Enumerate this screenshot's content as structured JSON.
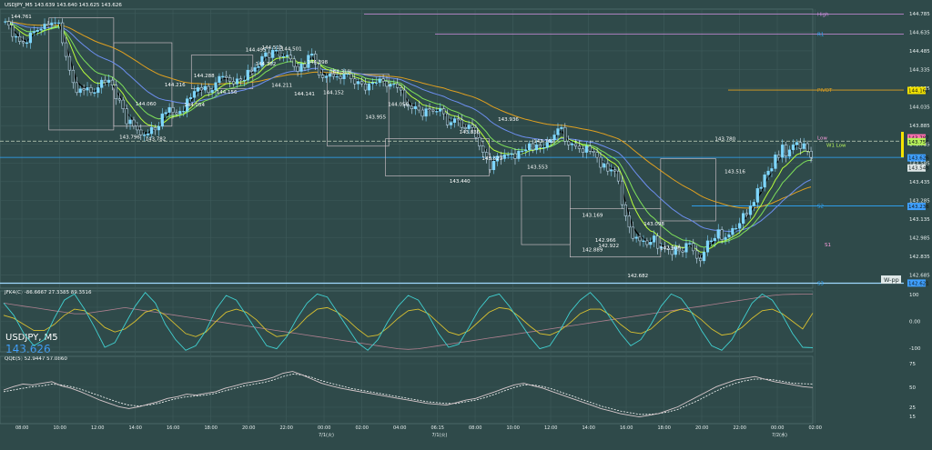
{
  "colors": {
    "background": "#2f4a4a",
    "grid": "#3e5b5b",
    "candle_up": "#7fd7ff",
    "candle_down": "#cfe9ff",
    "fast_ma": "#000000",
    "ma_green": "#b8ff3c",
    "ma_lightgreen": "#7ee05a",
    "ma_blue": "#6d8ff0",
    "ma_orange": "#e0a020",
    "pink": "#ff9fe0",
    "purple": "#d08fe0",
    "level_blue": "#2fa8ff",
    "box": "#d9c8d0"
  },
  "chart_data": [
    {
      "type": "candlestick",
      "title": "USDJPY_M5",
      "header": "USDJPY_M5  143.639  143.640  143.625  143.626",
      "symbol_label": "USDJPY, M5",
      "last_price": "143.626",
      "ylim": [
        142.58,
        144.82
      ],
      "x_ticks": [
        "08:00",
        "10:00",
        "12:00",
        "14:00",
        "16:00",
        "18:00",
        "20:00",
        "22:00",
        "00:00",
        "02:00",
        "04:00",
        "06:15",
        "08:00",
        "10:00",
        "12:00",
        "14:00",
        "16:00",
        "18:00",
        "20:00",
        "22:00",
        "00:00",
        "02:00"
      ],
      "date_labels": [
        {
          "after_tick": 8,
          "text": "7/1(火)"
        },
        {
          "after_tick": 11,
          "text": "7/1(火)"
        },
        {
          "after_tick": 20,
          "text": "7/2(水)"
        }
      ],
      "y_ticks": [
        "144.785",
        "144.635",
        "144.485",
        "144.335",
        "144.185",
        "144.035",
        "143.885",
        "143.735",
        "143.585",
        "143.435",
        "143.285",
        "143.135",
        "142.985",
        "142.835",
        "142.685"
      ],
      "price_tags": [
        "144.167",
        "143.787",
        "143.756",
        "143.626",
        "143.545",
        "143.236",
        "142.621"
      ],
      "level_labels": {
        "high": "High",
        "r1": "R1",
        "pivot": "PIVOT",
        "low": "Low",
        "w1_low": "W1 Low",
        "s2": "S2",
        "s1": "S1",
        "s3": "S3",
        "wpp": "W-pp"
      },
      "levels": {
        "high": 144.78,
        "r1": 144.62,
        "pivot": 144.17,
        "low": 143.76,
        "s1": 142.93,
        "s2": 143.24,
        "s3": 142.62
      },
      "price_annotations": [
        {
          "text": "144.761",
          "x": 4.5,
          "y": 144.761
        },
        {
          "text": "143.796",
          "x": 38,
          "y": 143.796
        },
        {
          "text": "143.782",
          "x": 46,
          "y": 143.782
        },
        {
          "text": "144.060",
          "x": 43,
          "y": 144.06
        },
        {
          "text": "144.216",
          "x": 52,
          "y": 144.216
        },
        {
          "text": "144.054",
          "x": 58,
          "y": 144.054
        },
        {
          "text": "144.288",
          "x": 61,
          "y": 144.288
        },
        {
          "text": "144.156",
          "x": 68,
          "y": 144.156
        },
        {
          "text": "144.495",
          "x": 77,
          "y": 144.495
        },
        {
          "text": "144.513",
          "x": 82,
          "y": 144.513
        },
        {
          "text": "144.501",
          "x": 88,
          "y": 144.501
        },
        {
          "text": "144.382",
          "x": 80,
          "y": 144.382
        },
        {
          "text": "144.211",
          "x": 85,
          "y": 144.211
        },
        {
          "text": "144.141",
          "x": 92,
          "y": 144.141
        },
        {
          "text": "144.398",
          "x": 96,
          "y": 144.398
        },
        {
          "text": "144.319",
          "x": 103,
          "y": 144.319
        },
        {
          "text": "144.152",
          "x": 101,
          "y": 144.152
        },
        {
          "text": "143.955",
          "x": 114,
          "y": 143.955
        },
        {
          "text": "144.056",
          "x": 121,
          "y": 144.056
        },
        {
          "text": "143.836",
          "x": 143,
          "y": 143.836
        },
        {
          "text": "143.936",
          "x": 155,
          "y": 143.936
        },
        {
          "text": "143.623",
          "x": 150,
          "y": 143.623
        },
        {
          "text": "143.762",
          "x": 166,
          "y": 143.762
        },
        {
          "text": "143.440",
          "x": 140,
          "y": 143.44
        },
        {
          "text": "143.553",
          "x": 164,
          "y": 143.553
        },
        {
          "text": "143.169",
          "x": 181,
          "y": 143.169
        },
        {
          "text": "142.889",
          "x": 181,
          "y": 142.889
        },
        {
          "text": "142.966",
          "x": 185,
          "y": 142.966
        },
        {
          "text": "142.922",
          "x": 186,
          "y": 142.922
        },
        {
          "text": "142.682",
          "x": 195,
          "y": 142.682
        },
        {
          "text": "143.098",
          "x": 200,
          "y": 143.098
        },
        {
          "text": "142.906",
          "x": 205,
          "y": 142.906
        },
        {
          "text": "143.780",
          "x": 222,
          "y": 143.78
        },
        {
          "text": "143.516",
          "x": 225,
          "y": 143.516
        }
      ],
      "box_labels": [
        {
          "text": "2",
          "x": 249,
          "y": 143.6
        }
      ],
      "series": [
        {
          "name": "close",
          "values": [
            144.72,
            144.69,
            144.6,
            144.6,
            144.56,
            144.55,
            144.55,
            144.63,
            144.64,
            144.65,
            144.66,
            144.7,
            144.69,
            144.71,
            144.71,
            144.71,
            144.55,
            144.44,
            144.33,
            144.23,
            144.15,
            144.18,
            144.17,
            144.19,
            144.15,
            144.15,
            144.19,
            144.25,
            144.23,
            144.25,
            144.21,
            144.1,
            144.09,
            144.02,
            143.9,
            143.93,
            143.88,
            143.85,
            143.81,
            143.81,
            143.82,
            143.87,
            143.85,
            143.88,
            143.98,
            143.99,
            144.03,
            143.99,
            143.98,
            144.0,
            144.0,
            144.1,
            144.11,
            144.16,
            144.19,
            144.17,
            144.2,
            144.15,
            144.17,
            144.23,
            144.28,
            144.28,
            144.27,
            144.24,
            144.22,
            144.26,
            144.25,
            144.25,
            144.33,
            144.32,
            144.35,
            144.36,
            144.44,
            144.47,
            144.43,
            144.49,
            144.49,
            144.44,
            144.44,
            144.45,
            144.42,
            144.36,
            144.32,
            144.38,
            144.35,
            144.45,
            144.46,
            144.38,
            144.29,
            144.27,
            144.28,
            144.3,
            144.28,
            144.28,
            144.26,
            144.3,
            144.3,
            144.26,
            144.22,
            144.24,
            144.22,
            144.17,
            144.22,
            144.23,
            144.23,
            144.26,
            144.24,
            144.2,
            144.22,
            144.22,
            144.19,
            144.17,
            144.05,
            144.04,
            144.02,
            144.04,
            144.01,
            143.96,
            144.02,
            144.01,
            144.0,
            144.0,
            144.02,
            143.98,
            143.89,
            143.91,
            143.94,
            143.93,
            143.87,
            143.86,
            143.89,
            143.87,
            143.79,
            143.72,
            143.67,
            143.63,
            143.53,
            143.6,
            143.64,
            143.62,
            143.65,
            143.65,
            143.66,
            143.62,
            143.68,
            143.68,
            143.69,
            143.74,
            143.69,
            143.73,
            143.71,
            143.71,
            143.75,
            143.77,
            143.81,
            143.86,
            143.87,
            143.76,
            143.73,
            143.74,
            143.72,
            143.7,
            143.67,
            143.72,
            143.68,
            143.67,
            143.63,
            143.55,
            143.58,
            143.52,
            143.53,
            143.52,
            143.44,
            143.25,
            143.16,
            143.07,
            142.98,
            142.99,
            142.96,
            142.96,
            142.93,
            142.95,
            143.0,
            142.9,
            142.91,
            142.9,
            142.89,
            142.85,
            142.91,
            142.88,
            142.87,
            142.94,
            142.94,
            142.88,
            142.82,
            142.8,
            142.87,
            142.96,
            142.96,
            142.98,
            143.05,
            142.97,
            142.99,
            143.01,
            143.06,
            143.06,
            143.1,
            143.18,
            143.17,
            143.24,
            143.27,
            143.38,
            143.39,
            143.49,
            143.52,
            143.54,
            143.65,
            143.63,
            143.73,
            143.64,
            143.69,
            143.73,
            143.75,
            143.7,
            143.74,
            143.68,
            143.63
          ]
        }
      ]
    },
    {
      "type": "line",
      "title": "JFK4(C) -86.6667 27.3385 89.3516",
      "ylim": [
        -100,
        100
      ],
      "y_ticks": [
        "100",
        "0.00",
        "-100"
      ],
      "series": [
        {
          "name": "fast",
          "values": [
            60,
            20,
            -40,
            -80,
            -60,
            10,
            70,
            90,
            40,
            -20,
            -85,
            -70,
            -10,
            50,
            95,
            60,
            -10,
            -60,
            -95,
            -80,
            -30,
            40,
            85,
            70,
            20,
            -30,
            -80,
            -90,
            -50,
            10,
            60,
            90,
            80,
            30,
            -20,
            -70,
            -95,
            -60,
            0,
            50,
            85,
            70,
            20,
            -40,
            -85,
            -75,
            -20,
            40,
            80,
            90,
            50,
            0,
            -50,
            -90,
            -80,
            -30,
            30,
            70,
            95,
            60,
            10,
            -40,
            -80,
            -60,
            -10,
            50,
            90,
            75,
            30,
            -30,
            -80,
            -95,
            -60,
            0,
            60,
            90,
            70,
            20,
            -40,
            -85,
            -86.7
          ]
        },
        {
          "name": "slow",
          "values": [
            20,
            10,
            -10,
            -30,
            -30,
            -10,
            20,
            40,
            35,
            10,
            -20,
            -35,
            -25,
            0,
            30,
            40,
            20,
            -10,
            -40,
            -50,
            -35,
            0,
            30,
            40,
            30,
            5,
            -30,
            -50,
            -45,
            -20,
            15,
            40,
            45,
            30,
            5,
            -25,
            -50,
            -45,
            -20,
            10,
            35,
            40,
            25,
            -5,
            -35,
            -45,
            -30,
            0,
            30,
            45,
            40,
            15,
            -15,
            -40,
            -45,
            -30,
            -5,
            25,
            40,
            40,
            20,
            -10,
            -35,
            -40,
            -25,
            5,
            30,
            40,
            30,
            5,
            -25,
            -45,
            -40,
            -20,
            10,
            35,
            40,
            25,
            0,
            -25,
            27.3
          ]
        },
        {
          "name": "base",
          "values": [
            60,
            55,
            50,
            45,
            40,
            35,
            30,
            25,
            25,
            30,
            35,
            40,
            45,
            40,
            35,
            30,
            25,
            20,
            15,
            10,
            5,
            0,
            -5,
            -10,
            -15,
            -20,
            -25,
            -30,
            -35,
            -40,
            -45,
            -50,
            -55,
            -60,
            -65,
            -70,
            -75,
            -80,
            -85,
            -90,
            -92,
            -90,
            -85,
            -80,
            -75,
            -70,
            -65,
            -60,
            -55,
            -50,
            -45,
            -40,
            -35,
            -30,
            -25,
            -20,
            -15,
            -10,
            -5,
            0,
            5,
            10,
            15,
            20,
            25,
            30,
            35,
            40,
            45,
            50,
            55,
            60,
            65,
            70,
            75,
            80,
            85,
            88,
            89,
            89.35,
            89.35
          ]
        }
      ]
    },
    {
      "type": "line",
      "title": "QQE(5) 52.9447 57.0860",
      "ylim": [
        10,
        90
      ],
      "y_ticks": [
        "75",
        "50",
        "25",
        "15"
      ],
      "series": [
        {
          "name": "qqe",
          "values": [
            50,
            54,
            57,
            56,
            58,
            60,
            55,
            52,
            48,
            43,
            38,
            34,
            30,
            28,
            30,
            33,
            36,
            40,
            42,
            45,
            44,
            46,
            48,
            52,
            55,
            58,
            60,
            62,
            65,
            70,
            72,
            68,
            63,
            58,
            55,
            52,
            50,
            48,
            46,
            44,
            42,
            40,
            38,
            36,
            34,
            33,
            32,
            35,
            38,
            40,
            44,
            48,
            52,
            56,
            58,
            55,
            52,
            48,
            44,
            40,
            36,
            32,
            28,
            25,
            22,
            20,
            18,
            20,
            22,
            26,
            30,
            36,
            42,
            48,
            54,
            58,
            62,
            64,
            66,
            63,
            60,
            58,
            56,
            54,
            52.9
          ]
        },
        {
          "name": "signal",
          "values": [
            48,
            50,
            52,
            54,
            55,
            57,
            56,
            54,
            51,
            47,
            43,
            39,
            35,
            32,
            31,
            32,
            34,
            37,
            40,
            42,
            43,
            44,
            46,
            49,
            52,
            55,
            57,
            59,
            62,
            66,
            69,
            68,
            65,
            61,
            58,
            55,
            52,
            50,
            48,
            46,
            44,
            42,
            40,
            38,
            36,
            35,
            34,
            34,
            36,
            38,
            41,
            45,
            49,
            53,
            56,
            56,
            54,
            51,
            47,
            43,
            39,
            35,
            31,
            28,
            25,
            23,
            21,
            21,
            22,
            24,
            27,
            32,
            37,
            43,
            49,
            54,
            58,
            61,
            63,
            63,
            62,
            60,
            58,
            57.5,
            57.1
          ]
        }
      ]
    }
  ]
}
